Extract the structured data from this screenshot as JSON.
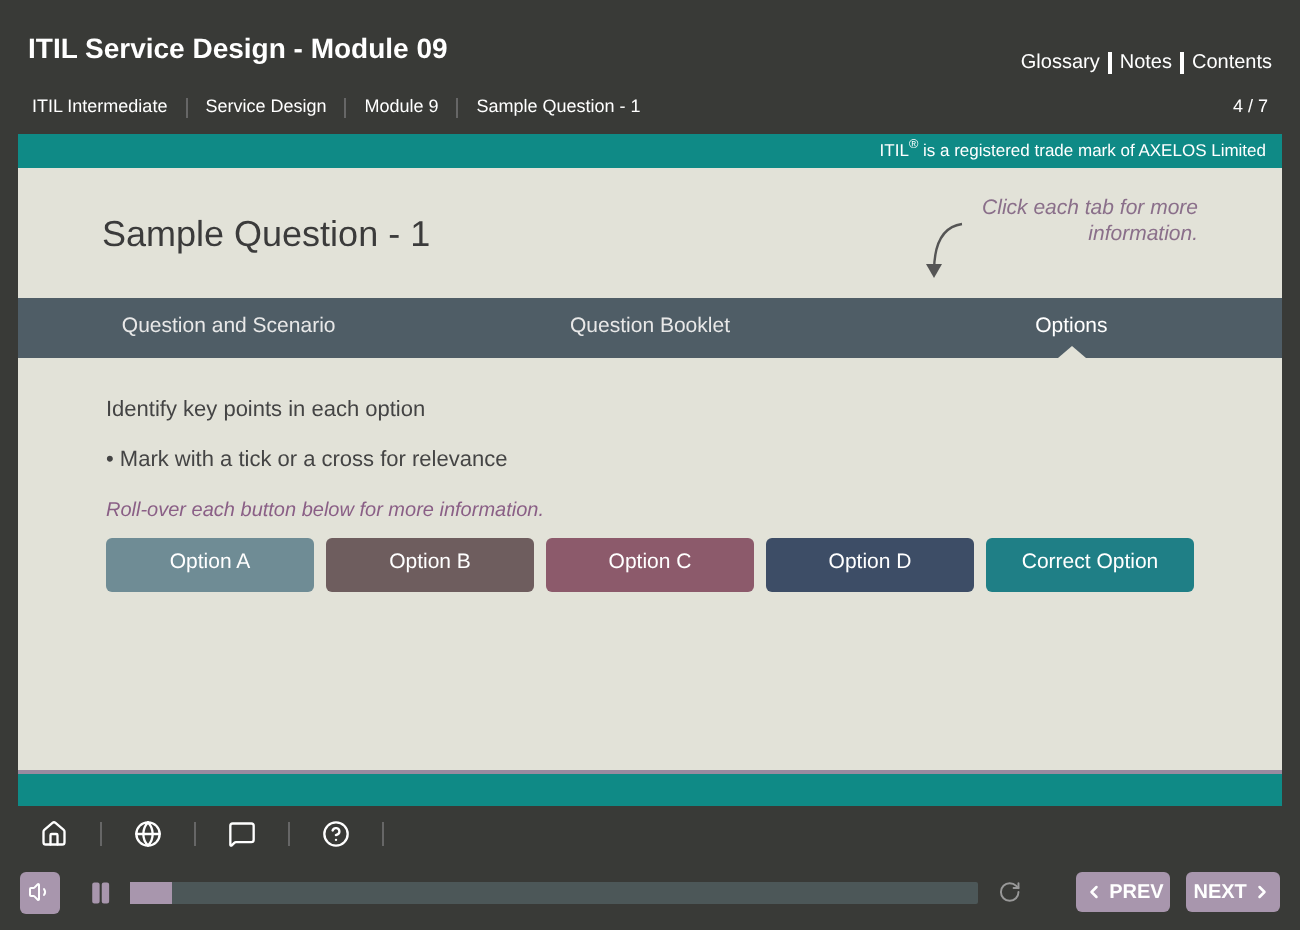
{
  "header": {
    "title": "ITIL Service Design - Module 09",
    "links": [
      "Glossary",
      "Notes",
      "Contents"
    ]
  },
  "breadcrumb": [
    "ITIL Intermediate",
    "Service Design",
    "Module 9",
    "Sample Question - 1"
  ],
  "page_count": "4 / 7",
  "trademark": "ITIL$^{®}$ is a registered trade mark of AXELOS Limited",
  "heading": "Sample Question - 1",
  "hint": "Click each tab for more information.",
  "tabs": [
    {
      "label": "Question and Scenario",
      "selected": false
    },
    {
      "label": "Question Booklet",
      "selected": false
    },
    {
      "label": "Options",
      "selected": true
    }
  ],
  "body": {
    "intro": "Identify key points in each option",
    "bullet": "• Mark with a tick or a cross for relevance",
    "note": "Roll-over each button below for more information."
  },
  "option_buttons": [
    {
      "label": "Option A",
      "color": "#6f8c95"
    },
    {
      "label": "Option B",
      "color": "#6e5d5e"
    },
    {
      "label": "Option C",
      "color": "#8c5a6b"
    },
    {
      "label": "Option D",
      "color": "#3d4d66"
    },
    {
      "label": "Correct Option",
      "color": "#1f7f86"
    }
  ],
  "player": {
    "level": 0.05,
    "prev": "PREV",
    "next": "NEXT"
  }
}
